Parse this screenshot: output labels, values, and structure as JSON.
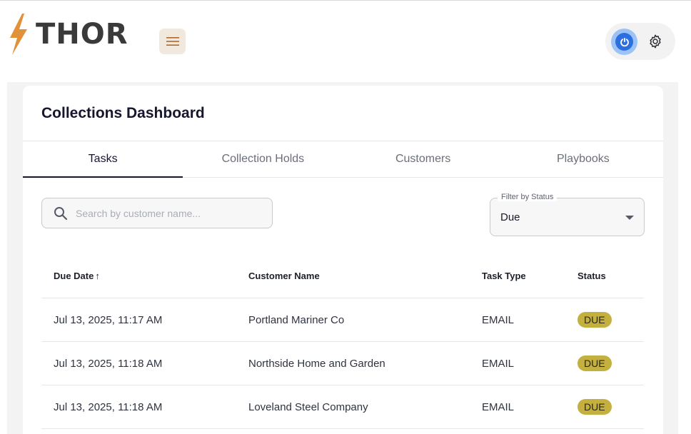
{
  "app": {
    "logo_text": "THOR"
  },
  "header": {
    "menu_icon": "hamburger-icon",
    "power_icon": "power-icon",
    "settings_icon": "gear-icon"
  },
  "dashboard": {
    "title": "Collections Dashboard",
    "tabs": [
      {
        "label": "Tasks",
        "active": true
      },
      {
        "label": "Collection Holds",
        "active": false
      },
      {
        "label": "Customers",
        "active": false
      },
      {
        "label": "Playbooks",
        "active": false
      }
    ],
    "search": {
      "placeholder": "Search by customer name...",
      "value": ""
    },
    "filter": {
      "label": "Filter by Status",
      "value": "Due"
    },
    "table": {
      "columns": [
        "Due Date",
        "Customer Name",
        "Task Type",
        "Status"
      ],
      "sort_indicator": "↑",
      "rows": [
        {
          "due_date": "Jul 13, 2025, 11:17 AM",
          "customer": "Portland Mariner Co",
          "task_type": "EMAIL",
          "status": "DUE"
        },
        {
          "due_date": "Jul 13, 2025, 11:18 AM",
          "customer": "Northside Home and Garden",
          "task_type": "EMAIL",
          "status": "DUE"
        },
        {
          "due_date": "Jul 13, 2025, 11:18 AM",
          "customer": "Loveland Steel Company",
          "task_type": "EMAIL",
          "status": "DUE"
        }
      ]
    }
  },
  "colors": {
    "accent": "#16162e",
    "logo_bolt": "#e0913a",
    "status_due": "#c4b03e",
    "power_button": "#2e6fe0",
    "menu_button_bg": "#f1e9dd"
  }
}
